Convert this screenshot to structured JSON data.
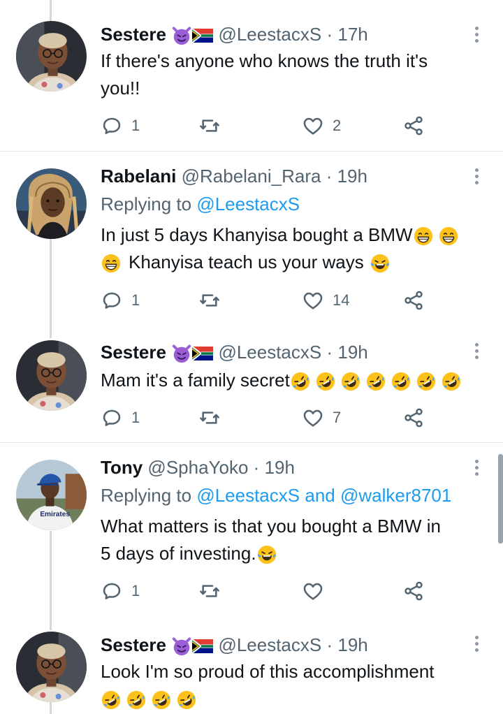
{
  "colors": {
    "accent": "#1d9bf0",
    "secondary_text": "#536471",
    "divider": "#e1e8ed",
    "thread_line": "#cfd9de"
  },
  "tweets": [
    {
      "name": "Sestere",
      "badges": [
        "smiling-imp-emoji",
        "south-africa-flag-emoji"
      ],
      "handle": "@LeestacxS",
      "separator": "·",
      "time": "17h",
      "replying_prefix": "",
      "replying_to": [],
      "text_lines": [
        "If there's anyone who knows the truth it's",
        "you!!"
      ],
      "trailing_emojis": [],
      "reply_count": "1",
      "like_count": "2"
    },
    {
      "name": "Rabelani",
      "badges": [],
      "handle": "@Rabelani_Rara",
      "separator": "·",
      "time": "19h",
      "replying_prefix": "Replying to",
      "replying_to": [
        "@LeestacxS"
      ],
      "text_lines": [
        "In just 5 days Khanyisa bought a BMW",
        "Khanyisa teach us your ways"
      ],
      "trailing_emojis": [
        "grinning-emoji",
        "grinning-emoji",
        "grinning-emoji",
        "tears-of-joy-emoji"
      ],
      "reply_count": "1",
      "like_count": "14"
    },
    {
      "name": "Sestere",
      "badges": [
        "smiling-imp-emoji",
        "south-africa-flag-emoji"
      ],
      "handle": "@LeestacxS",
      "separator": "·",
      "time": "19h",
      "replying_prefix": "",
      "replying_to": [],
      "text_lines": [
        "Mam it's a family secret"
      ],
      "trailing_emojis": [
        "rofl-emoji",
        "rofl-emoji",
        "rofl-emoji",
        "rofl-emoji",
        "rofl-emoji",
        "rofl-emoji",
        "rofl-emoji"
      ],
      "reply_count": "1",
      "like_count": "7"
    },
    {
      "name": "Tony",
      "badges": [],
      "handle": "@SphaYoko",
      "separator": "·",
      "time": "19h",
      "replying_prefix": "Replying to",
      "replying_to": [
        "@LeestacxS",
        "and",
        "@walker8701"
      ],
      "text_lines": [
        "What matters is that you bought a BMW in",
        "5 days of investing."
      ],
      "trailing_emojis": [
        "tears-of-joy-emoji"
      ],
      "reply_count": "1",
      "like_count": ""
    },
    {
      "name": "Sestere",
      "badges": [
        "smiling-imp-emoji",
        "south-africa-flag-emoji"
      ],
      "handle": "@LeestacxS",
      "separator": "·",
      "time": "19h",
      "replying_prefix": "",
      "replying_to": [],
      "text_lines": [
        "Look I'm so proud of this accomplishment"
      ],
      "trailing_emojis": [
        "rofl-emoji",
        "rofl-emoji",
        "rofl-emoji",
        "rofl-emoji"
      ],
      "reply_count": "",
      "like_count": ""
    }
  ]
}
